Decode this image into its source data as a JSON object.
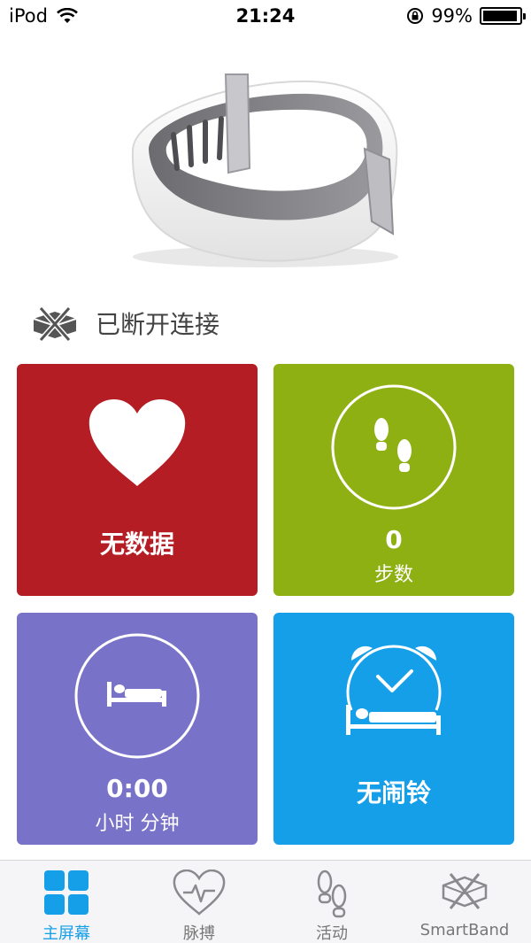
{
  "status_bar": {
    "carrier": "iPod",
    "time": "21:24",
    "battery": "99%",
    "battery_level": 0.99
  },
  "device": {
    "status": "已断开连接",
    "status_icon": "disconnected-band-icon"
  },
  "tiles": {
    "heart": {
      "title": "无数据",
      "icon": "heart-icon"
    },
    "steps": {
      "value": "0",
      "unit": "步数",
      "icon": "footsteps-icon"
    },
    "sleep": {
      "value": "0:00",
      "unit": "小时 分钟",
      "icon": "bed-icon"
    },
    "alarm": {
      "title": "无闹铃",
      "icon": "alarm-clock-icon"
    }
  },
  "tab_bar": {
    "tabs": [
      {
        "label": "主屏幕",
        "icon": "grid-icon",
        "active": true
      },
      {
        "label": "脉搏",
        "icon": "pulse-heart-icon",
        "active": false
      },
      {
        "label": "活动",
        "icon": "footsteps-icon",
        "active": false
      },
      {
        "label": "SmartBand",
        "icon": "smartband-icon",
        "active": false
      }
    ]
  },
  "colors": {
    "heart_tile": "#b51d25",
    "steps_tile": "#8eb012",
    "sleep_tile": "#7972c9",
    "alarm_tile": "#169fe9",
    "tab_active": "#169fe9",
    "tab_inactive": "#777777"
  }
}
